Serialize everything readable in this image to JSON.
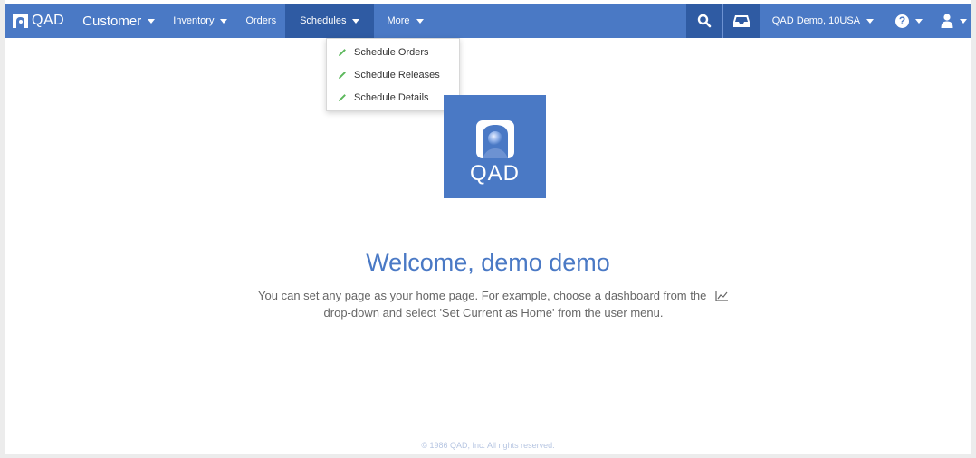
{
  "brand": {
    "name": "QAD"
  },
  "nav": {
    "customer": "Customer",
    "inventory": "Inventory",
    "orders": "Orders",
    "schedules": "Schedules",
    "more": "More"
  },
  "user_context": "QAD Demo, 10USA",
  "icons": {
    "search": "search-icon",
    "inbox": "inbox-icon",
    "help": "help-icon",
    "user": "user-icon",
    "help_glyph": "?"
  },
  "dropdown": {
    "items": [
      {
        "label": "Schedule Orders",
        "icon": "pencil-icon"
      },
      {
        "label": "Schedule Releases",
        "icon": "pencil-icon"
      },
      {
        "label": "Schedule Details",
        "icon": "pencil-icon"
      }
    ]
  },
  "logo_tile": {
    "text": "QAD"
  },
  "welcome": "Welcome, demo demo",
  "info": {
    "line1": "You can set any page as your home page. For example, choose a dashboard from the",
    "line2": "drop-down and select 'Set Current as Home' from the user menu."
  },
  "footer": "© 1986 QAD, Inc. All rights reserved.",
  "colors": {
    "primary": "#4a79c5",
    "primary_dark": "#2f5ba3",
    "pencil": "#5cb85c",
    "text_muted": "#666666"
  }
}
